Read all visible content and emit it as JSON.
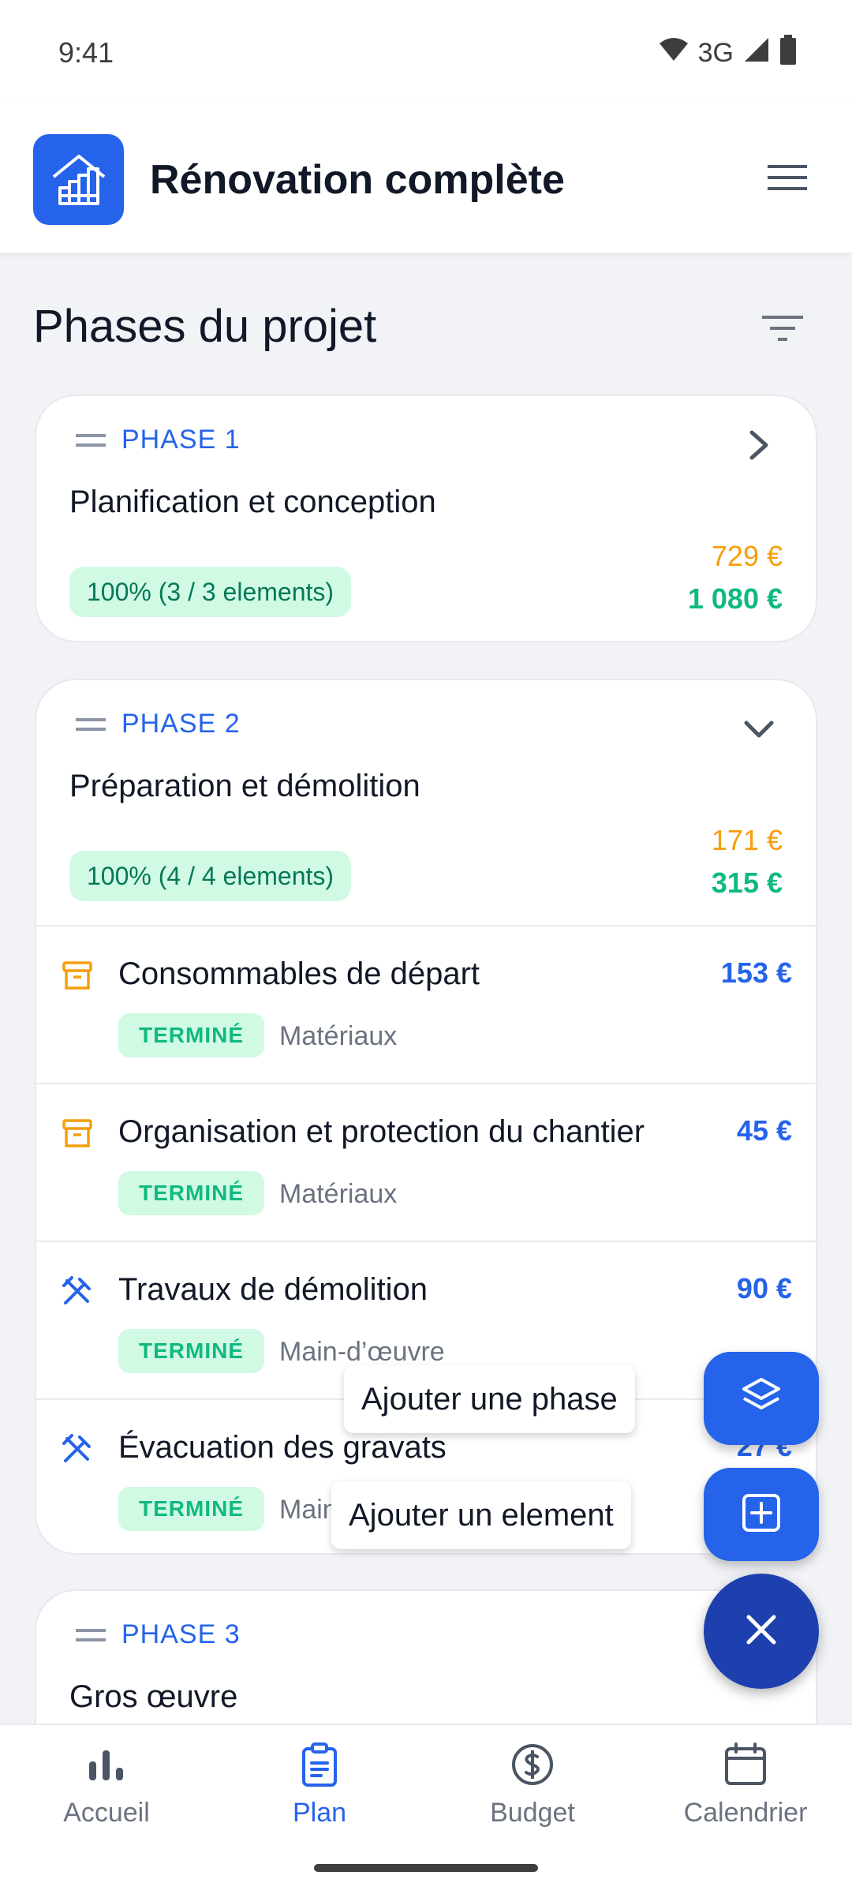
{
  "status": {
    "time": "9:41",
    "network": "3G"
  },
  "header": {
    "title": "Rénovation complète",
    "logo_icon": "house-chart-icon",
    "menu_icon": "hamburger-icon"
  },
  "section": {
    "title": "Phases du projet",
    "filter_icon": "filter-icon"
  },
  "phases": [
    {
      "label": "PHASE 1",
      "name": "Planification et conception",
      "progress": "100% (3 / 3 elements)",
      "amount_planned": "729 €",
      "amount_total": "1 080 €",
      "expanded": false
    },
    {
      "label": "PHASE 2",
      "name": "Préparation et démolition",
      "progress": "100% (4 / 4 elements)",
      "amount_planned": "171 €",
      "amount_total": "315 €",
      "expanded": true,
      "items": [
        {
          "name": "Consommables de départ",
          "amount": "153 €",
          "status": "TERMINÉ",
          "category": "Matériaux",
          "icon": "box-icon"
        },
        {
          "name": "Organisation et protection du chantier",
          "amount": "45 €",
          "status": "TERMINÉ",
          "category": "Matériaux",
          "icon": "box-icon"
        },
        {
          "name": "Travaux de démolition",
          "amount": "90 €",
          "status": "TERMINÉ",
          "category": "Main-d’œuvre",
          "icon": "tools-icon"
        },
        {
          "name": "Évacuation des gravats",
          "amount": "27 €",
          "status": "TERMINÉ",
          "category": "Main-d’œuvre",
          "icon": "tools-icon"
        }
      ]
    },
    {
      "label": "PHASE 3",
      "name": "Gros œuvre"
    }
  ],
  "fab": {
    "add_phase": "Ajouter une phase",
    "add_element": "Ajouter un element"
  },
  "nav": [
    {
      "label": "Accueil",
      "icon": "bar-chart-icon"
    },
    {
      "label": "Plan",
      "icon": "clipboard-icon",
      "active": true
    },
    {
      "label": "Budget",
      "icon": "dollar-circle-icon"
    },
    {
      "label": "Calendrier",
      "icon": "calendar-icon"
    }
  ],
  "colors": {
    "accent": "#2563eb",
    "success": "#10b981",
    "warning": "#f59e0b"
  }
}
